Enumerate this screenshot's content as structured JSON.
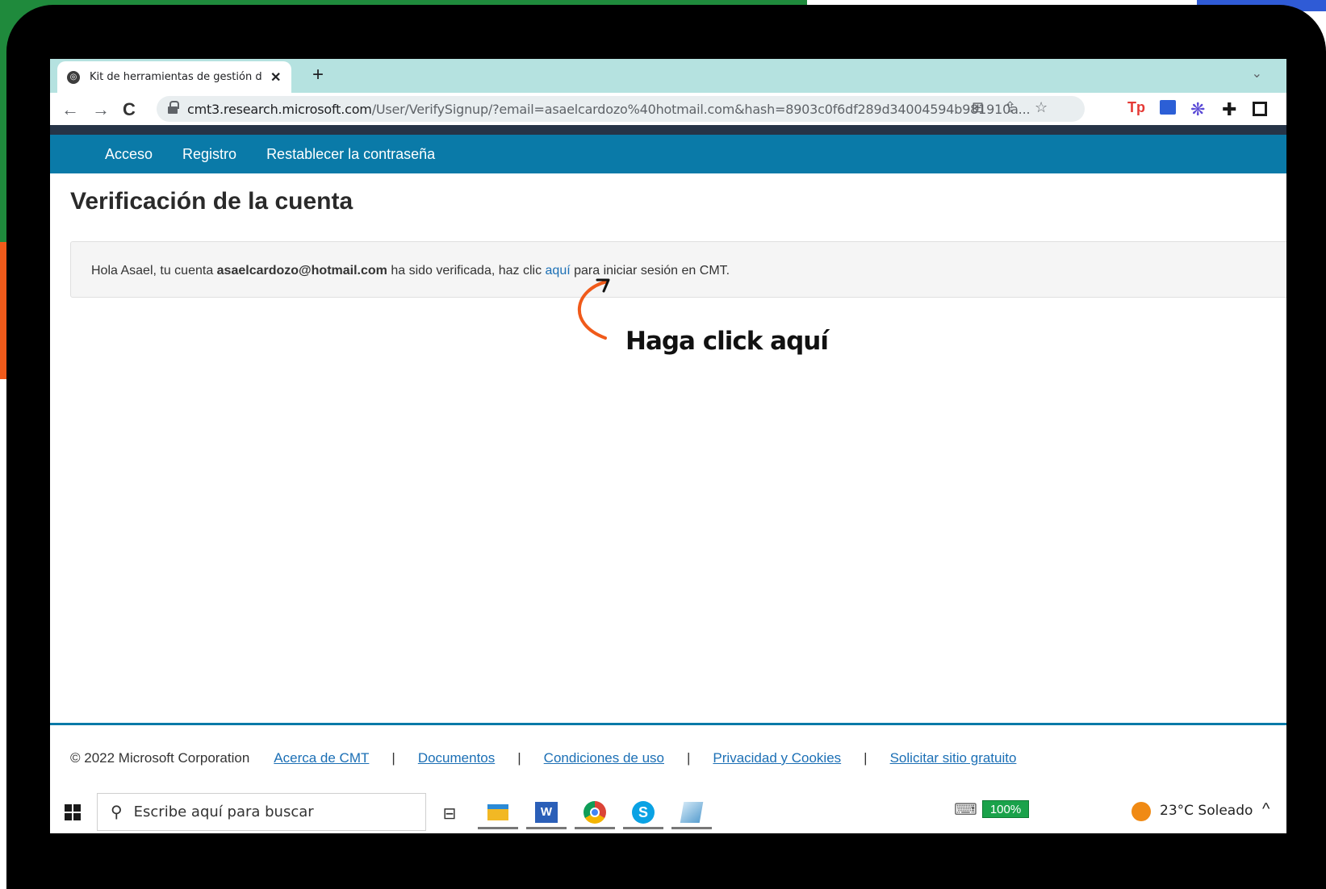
{
  "browser": {
    "tab_title": "Kit de herramientas de gestión d",
    "tab_close": "✕",
    "new_tab": "+",
    "tab_dropdown": "⌄",
    "url_host": "cmt3.research.microsoft.com",
    "url_path": "/User/VerifySignup/?email=asaelcardozo%40hotmail.com&hash=8903c0f6df289d34004594b981910a..."
  },
  "site_nav": {
    "items": [
      "Acceso",
      "Registro",
      "Restablecer la contraseña"
    ]
  },
  "page": {
    "title": "Verificación de la cuenta",
    "message_before": "Hola Asael, tu cuenta ",
    "email": "asaelcardozo@hotmail.com",
    "message_middle": " ha sido verificada, haz clic ",
    "link_text": "aquí",
    "message_after": " para iniciar sesión en CMT."
  },
  "annotation": {
    "text": "Haga click aquí",
    "color": "#f05a1a"
  },
  "footer": {
    "copyright": "© 2022 Microsoft Corporation",
    "links": [
      "Acerca de CMT",
      "Documentos",
      "Condiciones de uso",
      "Privacidad y Cookies",
      "Solicitar sitio gratuito"
    ],
    "separator": "|"
  },
  "taskbar": {
    "search_placeholder": "Escribe aquí para buscar",
    "battery": "100%",
    "weather": "23°C  Soleado",
    "apps": [
      "task-view",
      "file-explorer",
      "word",
      "chrome",
      "skype",
      "notepad"
    ]
  },
  "colors": {
    "nav_bar": "#0a7aa8",
    "tab_strip": "#b5e2e0",
    "link": "#1b6fb5"
  }
}
